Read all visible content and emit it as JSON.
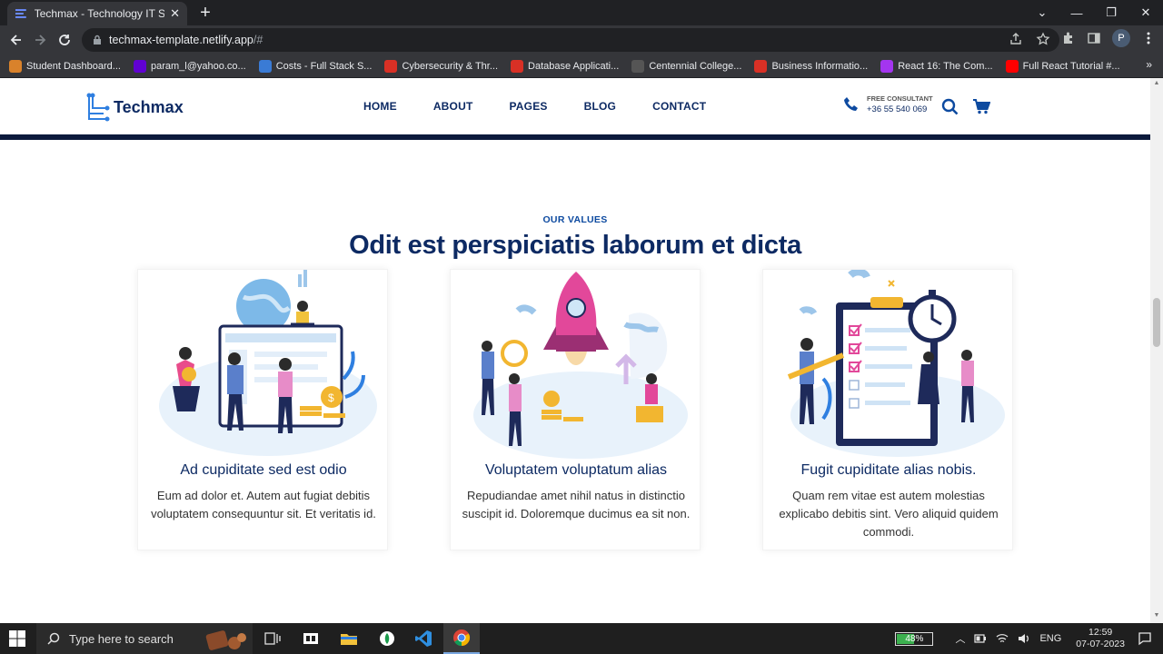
{
  "browser": {
    "tab_title": "Techmax - Technology IT Solution",
    "new_tab": "+",
    "tab_close": "✕",
    "url_host": "techmax-template.netlify.app",
    "url_path": "/#",
    "profile_initial": "P",
    "window_controls": [
      "—",
      "❐",
      "✕"
    ],
    "bookmarks": [
      {
        "label": "Student Dashboard...",
        "icon": "colorful-star-icon",
        "color": "#d9822b"
      },
      {
        "label": "param_l@yahoo.co...",
        "icon": "yahoo-icon",
        "color": "#6001d2"
      },
      {
        "label": "Costs - Full Stack S...",
        "icon": "globe-icon",
        "color": "#3a7bd5"
      },
      {
        "label": "Cybersecurity & Thr...",
        "icon": "s-logo-icon",
        "color": "#d93025"
      },
      {
        "label": "Database Applicati...",
        "icon": "s-logo-icon",
        "color": "#d93025"
      },
      {
        "label": "Centennial College...",
        "icon": "c-logo-icon",
        "color": "#555555"
      },
      {
        "label": "Business Informatio...",
        "icon": "s-logo-icon",
        "color": "#d93025"
      },
      {
        "label": "React 16: The Com...",
        "icon": "udemy-icon",
        "color": "#a435f0"
      },
      {
        "label": "Full React Tutorial #...",
        "icon": "youtube-icon",
        "color": "#ff0000"
      }
    ],
    "bookmarks_more": "»"
  },
  "site": {
    "logo_text": "Techmax",
    "nav": [
      "HOME",
      "ABOUT",
      "PAGES",
      "BLOG",
      "CONTACT"
    ],
    "consult_label": "FREE CONSULTANT",
    "consult_phone": "+36 55 540 069",
    "colors": {
      "primary": "#0d2a63",
      "eyebrow": "#0d4aa0",
      "header_bar": "#0c1a3c"
    }
  },
  "section": {
    "eyebrow": "OUR VALUES",
    "title": "Odit est perspiciatis laborum et dicta",
    "cards": [
      {
        "title": "Ad cupiditate sed est odio",
        "text": "Eum ad dolor et. Autem aut fugiat debitis voluptatem consequuntur sit. Et veritatis id.",
        "illustration": "team-dashboard-illustration"
      },
      {
        "title": "Voluptatem voluptatum alias",
        "text": "Repudiandae amet nihil natus in distinctio suscipit id. Doloremque ducimus ea sit non.",
        "illustration": "rocket-launch-illustration"
      },
      {
        "title": "Fugit cupiditate alias nobis.",
        "text": "Quam rem vitae est autem molestias explicabo debitis sint. Vero aliquid quidem commodi.",
        "illustration": "checklist-clipboard-illustration"
      }
    ]
  },
  "taskbar": {
    "search_placeholder": "Type here to search",
    "battery_percent": "48%",
    "battery_level": 0.48,
    "language": "ENG",
    "time": "12:59",
    "date": "07-07-2023"
  }
}
